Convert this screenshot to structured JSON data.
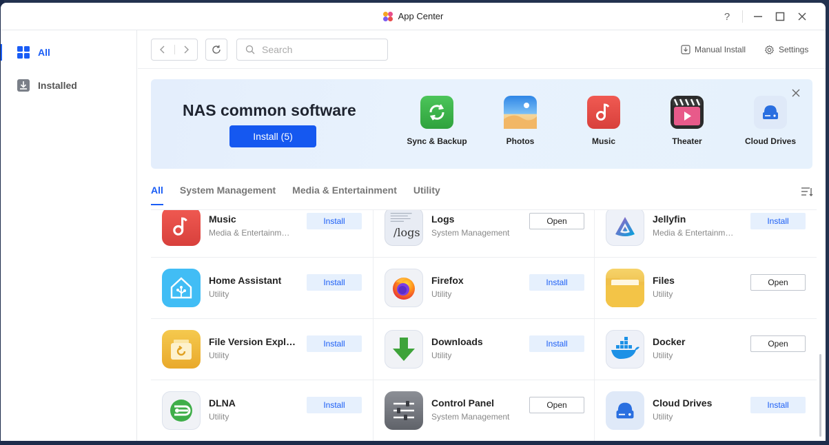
{
  "window": {
    "title": "App Center"
  },
  "title_controls": {
    "help": "?",
    "minimize": "—",
    "maximize": "☐",
    "close": "✕"
  },
  "sidebar": {
    "items": [
      {
        "label": "All",
        "icon": "grid-icon",
        "active": true
      },
      {
        "label": "Installed",
        "icon": "download-box-icon",
        "active": false
      }
    ]
  },
  "toolbar": {
    "search_placeholder": "Search",
    "manual_install": "Manual Install",
    "settings": "Settings"
  },
  "banner": {
    "title": "NAS common software",
    "install_label": "Install (5)",
    "apps": [
      {
        "label": "Sync & Backup",
        "icon": "sync-icon",
        "color": "#3db54a"
      },
      {
        "label": "Photos",
        "icon": "photos-icon",
        "color": "#2b8de6"
      },
      {
        "label": "Music",
        "icon": "music-note-icon",
        "color": "#e8504a"
      },
      {
        "label": "Theater",
        "icon": "theater-icon",
        "color": "#2a2a2a"
      },
      {
        "label": "Cloud Drives",
        "icon": "cloud-drive-icon",
        "color": "#2a6fe0"
      }
    ]
  },
  "tabs": [
    "All",
    "System Management",
    "Media & Entertainment",
    "Utility"
  ],
  "apps": [
    {
      "name": "Music",
      "category": "Media & Entertainment",
      "action": "Install",
      "icon": "music-note-icon"
    },
    {
      "name": "Logs",
      "category": "System Management",
      "action": "Open",
      "icon": "logs-icon"
    },
    {
      "name": "Jellyfin",
      "category": "Media & Entertainment",
      "action": "Install",
      "icon": "jellyfin-icon"
    },
    {
      "name": "Home Assistant",
      "category": "Utility",
      "action": "Install",
      "icon": "home-assistant-icon"
    },
    {
      "name": "Firefox",
      "category": "Utility",
      "action": "Install",
      "icon": "firefox-icon"
    },
    {
      "name": "Files",
      "category": "Utility",
      "action": "Open",
      "icon": "folder-icon"
    },
    {
      "name": "File Version Explorer",
      "category": "Utility",
      "action": "Install",
      "icon": "file-version-icon"
    },
    {
      "name": "Downloads",
      "category": "Utility",
      "action": "Install",
      "icon": "download-arrow-icon"
    },
    {
      "name": "Docker",
      "category": "Utility",
      "action": "Open",
      "icon": "docker-icon"
    },
    {
      "name": "DLNA",
      "category": "Utility",
      "action": "Install",
      "icon": "dlna-icon"
    },
    {
      "name": "Control Panel",
      "category": "System Management",
      "action": "Open",
      "icon": "control-panel-icon"
    },
    {
      "name": "Cloud Drives",
      "category": "Utility",
      "action": "Install",
      "icon": "cloud-drive-icon"
    }
  ],
  "logs_icon_text": "/logs"
}
